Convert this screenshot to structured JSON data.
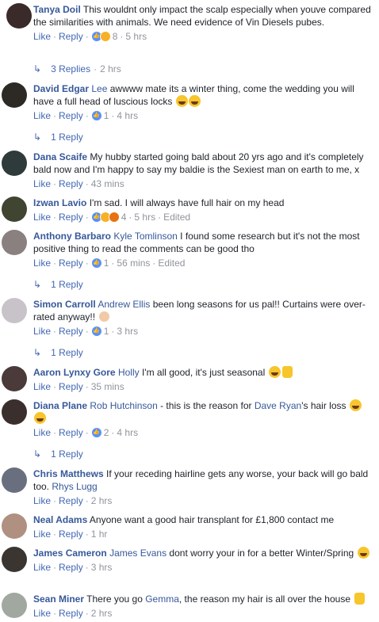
{
  "labels": {
    "like": "Like",
    "reply": "Reply",
    "dot": "·"
  },
  "comments": [
    {
      "author": "Tanya Doil",
      "text_parts": [
        {
          "t": "This wouldnt only impact the scalp especially when youve compared the similarities with animals. We need evidence of Vin Diesels pubes."
        }
      ],
      "reactions": [
        "like",
        "haha"
      ],
      "reaction_count": "8",
      "time": "5 hrs",
      "replies": {
        "label": "3 Replies",
        "time": "2 hrs"
      },
      "avatar_color": "#3a2a2a"
    },
    {
      "author": "David Edgar",
      "text_parts": [
        {
          "t": "Lee",
          "mention": true
        },
        {
          "t": " awwww mate its a winter thing, come the wedding you will have a full head of luscious locks "
        }
      ],
      "trailing_emoji": [
        "laugh",
        "laugh"
      ],
      "reactions": [
        "like"
      ],
      "reaction_count": "1",
      "time": "4 hrs",
      "replies": {
        "label": "1 Reply"
      },
      "avatar_color": "#2d2a25"
    },
    {
      "author": "Dana Scaife",
      "text_parts": [
        {
          "t": "My hubby started going bald about 20 yrs ago and it's completely bald now and I'm happy to say my baldie is the Sexiest man on earth to me, x"
        }
      ],
      "time": "43 mins",
      "avatar_color": "#2f3a3a"
    },
    {
      "author": "Izwan Lavio",
      "text_parts": [
        {
          "t": "I'm sad. I will always have full hair on my head"
        }
      ],
      "reactions": [
        "like",
        "haha",
        "angry"
      ],
      "reaction_count": "4",
      "time": "5 hrs",
      "edited": "Edited",
      "avatar_color": "#3f4530"
    },
    {
      "author": "Anthony Barbaro",
      "text_parts": [
        {
          "t": "Kyle Tomlinson",
          "mention": true
        },
        {
          "t": " I found some research but it's not the most positive thing to read the comments can be good tho"
        }
      ],
      "reactions": [
        "like"
      ],
      "reaction_count": "1",
      "time": "56 mins",
      "edited": "Edited",
      "replies": {
        "label": "1 Reply"
      },
      "avatar_color": "#8a8080"
    },
    {
      "author": "Simon Carroll",
      "text_parts": [
        {
          "t": "Andrew Ellis",
          "mention": true
        },
        {
          "t": " been long seasons for us pal!! Curtains were over-rated anyway!! "
        }
      ],
      "trailing_emoji": [
        "face"
      ],
      "reactions": [
        "like"
      ],
      "reaction_count": "1",
      "time": "3 hrs",
      "replies": {
        "label": "1 Reply"
      },
      "avatar_color": "#c8c3c8"
    },
    {
      "author": "Aaron Lynxy Gore",
      "text_parts": [
        {
          "t": "Holly",
          "mention": true
        },
        {
          "t": " I'm all good, it's just seasonal "
        }
      ],
      "trailing_emoji": [
        "laugh",
        "thumb"
      ],
      "time": "35 mins",
      "avatar_color": "#4a3a3a"
    },
    {
      "author": "Diana Plane",
      "text_parts": [
        {
          "t": "Rob Hutchinson",
          "mention": true
        },
        {
          "t": " - this is the reason for "
        },
        {
          "t": "Dave Ryan",
          "mention": true
        },
        {
          "t": "'s hair loss "
        }
      ],
      "trailing_emoji": [
        "laugh",
        "laugh"
      ],
      "reactions": [
        "like"
      ],
      "reaction_count": "2",
      "time": "4 hrs",
      "replies": {
        "label": "1 Reply"
      },
      "avatar_color": "#3a2f2c"
    },
    {
      "author": "Chris Matthews",
      "text_parts": [
        {
          "t": "If your receding hairline gets any worse, your back will go bald too. "
        },
        {
          "t": "Rhys Lugg",
          "mention": true
        }
      ],
      "time": "2 hrs",
      "avatar_color": "#6a6f80"
    },
    {
      "author": "Neal Adams",
      "text_parts": [
        {
          "t": "Anyone want a good hair transplant for £1,800 contact me"
        }
      ],
      "time": "1 hr",
      "avatar_color": "#b09080"
    },
    {
      "author": "James Cameron",
      "text_parts": [
        {
          "t": "James Evans",
          "mention": true
        },
        {
          "t": " dont worry your in for a better Winter/Spring "
        }
      ],
      "trailing_emoji": [
        "laugh"
      ],
      "time": "3 hrs",
      "avatar_color": "#3a3530"
    },
    {
      "author": "Sean Miner",
      "text_parts": [
        {
          "t": "There you go "
        },
        {
          "t": "Gemma",
          "mention": true
        },
        {
          "t": ", the reason my hair is all over the house "
        }
      ],
      "trailing_emoji": [
        "thumb"
      ],
      "time": "2 hrs",
      "avatar_color": "#a0a8a0"
    }
  ]
}
